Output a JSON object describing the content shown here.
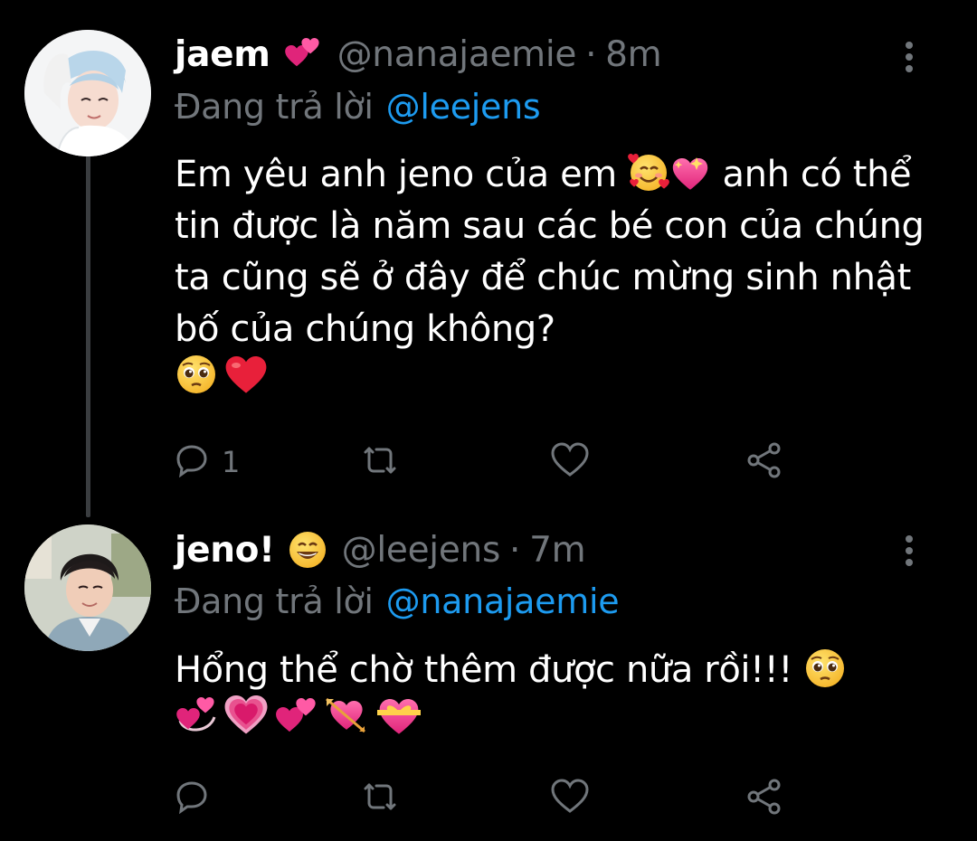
{
  "tweets": [
    {
      "display_name": "jaem",
      "name_emoji": "two-hearts",
      "handle": "@nanajaemie",
      "separator": "·",
      "time": "8m",
      "reply_prefix": "Đang trả lời",
      "reply_to": "@leejens",
      "body_parts": [
        "Em yêu anh jeno của em",
        "anh có thể tin được là năm sau các bé con của chúng ta cũng sẽ ở đây để chúc mừng sinh nhật bố của chúng không?"
      ],
      "body_emojis_inline": [
        "smiling-face-with-hearts",
        "sparkling-heart"
      ],
      "body_emojis_end": [
        "pleading-face",
        "red-heart"
      ],
      "reply_count": "1",
      "avatar": "avatar-jaem"
    },
    {
      "display_name": "jeno!",
      "name_emoji": "grinning-face",
      "handle": "@leejens",
      "separator": "·",
      "time": "7m",
      "reply_prefix": "Đang trả lời",
      "reply_to": "@nanajaemie",
      "body_text": "Hổng thể chờ thêm được nữa rồi!!!",
      "body_emojis_inline": [
        "pleading-face"
      ],
      "body_emojis_end": [
        "revolving-hearts",
        "growing-heart",
        "two-hearts",
        "heart-with-arrow",
        "heart-with-ribbon"
      ],
      "reply_count": "",
      "avatar": "avatar-jeno"
    }
  ],
  "colors": {
    "background": "#000000",
    "text_primary": "#ffffff",
    "text_secondary": "#71767b",
    "link": "#1d9bf0",
    "thread_line": "#3a3d40"
  },
  "icons": {
    "reply": "reply-icon",
    "retweet": "retweet-icon",
    "like": "heart-outline-icon",
    "share": "share-icon",
    "more": "more-vertical-icon"
  }
}
